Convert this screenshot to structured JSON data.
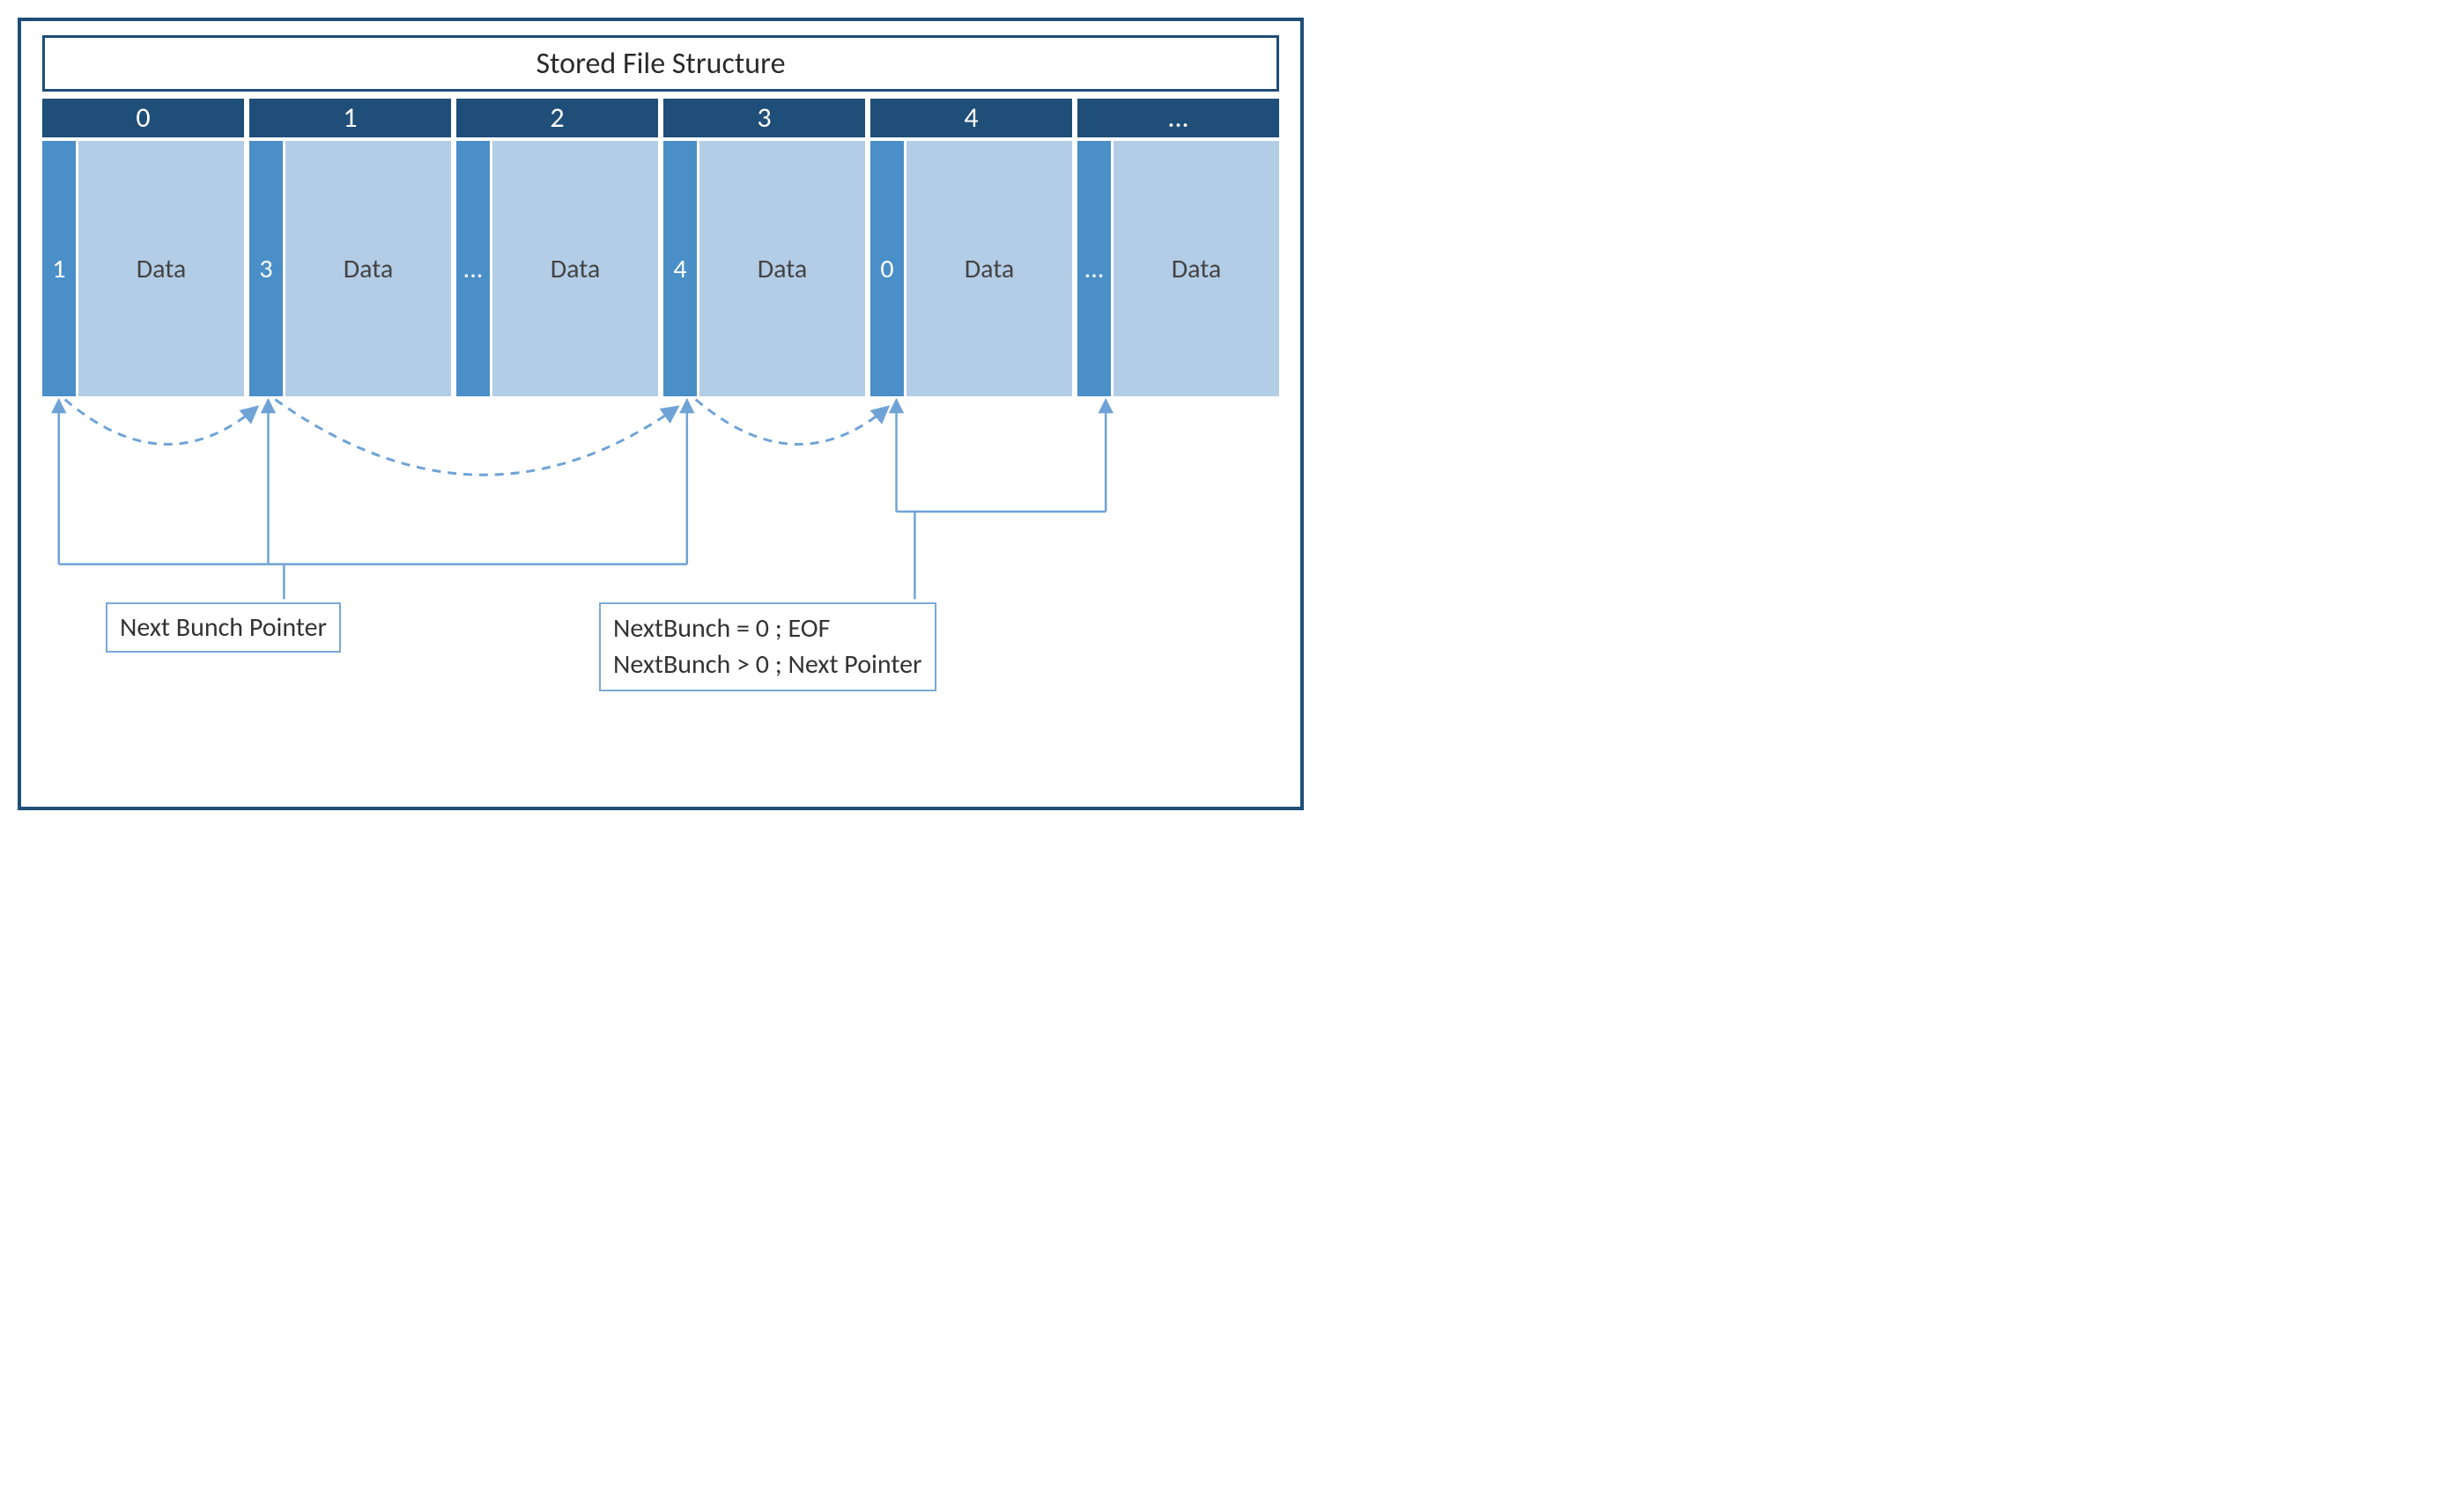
{
  "title": "Stored File Structure",
  "blocks": [
    {
      "index": "0",
      "pointer": "1",
      "data": "Data"
    },
    {
      "index": "1",
      "pointer": "3",
      "data": "Data"
    },
    {
      "index": "2",
      "pointer": "...",
      "data": "Data"
    },
    {
      "index": "3",
      "pointer": "4",
      "data": "Data"
    },
    {
      "index": "4",
      "pointer": "0",
      "data": "Data"
    },
    {
      "index": "...",
      "pointer": "...",
      "data": "Data"
    }
  ],
  "labels": {
    "next_bunch_pointer": "Next Bunch Pointer",
    "rule_line1": "NextBunch = 0 ; EOF",
    "rule_line2": "NextBunch > 0 ; Next Pointer"
  }
}
